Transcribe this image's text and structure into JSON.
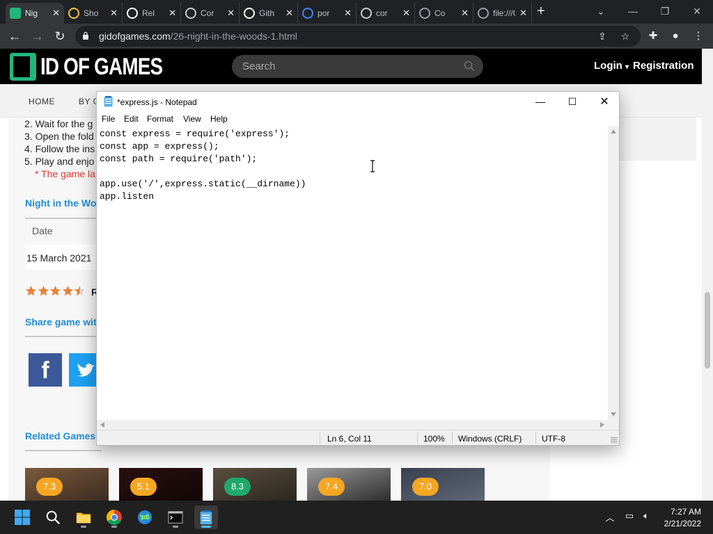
{
  "browser": {
    "tabs": [
      {
        "label": "Nig",
        "active": true,
        "favicon": "gidofgames-icon",
        "color": "#24b57f"
      },
      {
        "label": "Sho",
        "favicon": "shopping-icon",
        "color": "#f5c542"
      },
      {
        "label": "Rel",
        "favicon": "github-icon",
        "color": "#ffffff"
      },
      {
        "label": "Cor",
        "favicon": "geek-icon",
        "color": "#cccccc"
      },
      {
        "label": "Gith",
        "favicon": "github-icon",
        "color": "#ffffff"
      },
      {
        "label": "por",
        "favicon": "chrome-icon",
        "color": "#4285f4"
      },
      {
        "label": "cor",
        "favicon": "geek-icon",
        "color": "#cccccc"
      },
      {
        "label": "Co",
        "favicon": "globe-icon",
        "color": "#9aa0a6"
      },
      {
        "label": "file:///C",
        "favicon": "globe-icon",
        "color": "#9aa0a6"
      }
    ],
    "url_host": "gidofgames.com",
    "url_path": "/26-night-in-the-woods-1.html"
  },
  "site": {
    "logo_text": "ID OF GAMES",
    "search_placeholder": "Search",
    "login": "Login",
    "register": "Registration",
    "nav": [
      "HOME",
      "BY G"
    ],
    "steps": [
      "2. Wait for the g",
      "3. Open the fold",
      "4. Follow the ins",
      "5. Play and enjo"
    ],
    "warning": "* The game la",
    "section_title": "Night in the Wo",
    "date_label": "Date",
    "date_value": "15 March 2021",
    "rating_stars": 4.5,
    "rating_letter": "R",
    "share_title": "Share game wit",
    "related_title": "Related Games",
    "related_scores": [
      "7.3",
      "5.1",
      "8.3",
      "7.4",
      "7.0"
    ]
  },
  "notepad": {
    "title": "*express.js - Notepad",
    "menu": [
      "File",
      "Edit",
      "Format",
      "View",
      "Help"
    ],
    "lines": [
      "const express = require('express');",
      "const app = express();",
      "const path = require('path');",
      "",
      "app.use('/',express.static(__dirname))",
      "app.listen"
    ],
    "status": {
      "position": "Ln 6, Col 11",
      "zoom": "100%",
      "line_ending": "Windows (CRLF)",
      "encoding": "UTF-8"
    }
  },
  "taskbar": {
    "apps": [
      "windows-start-icon",
      "search-icon",
      "file-explorer-icon",
      "chrome-icon",
      "network-app-icon",
      "terminal-icon",
      "notepad-icon"
    ],
    "time": "7:27 AM",
    "date": "2/21/2022"
  }
}
